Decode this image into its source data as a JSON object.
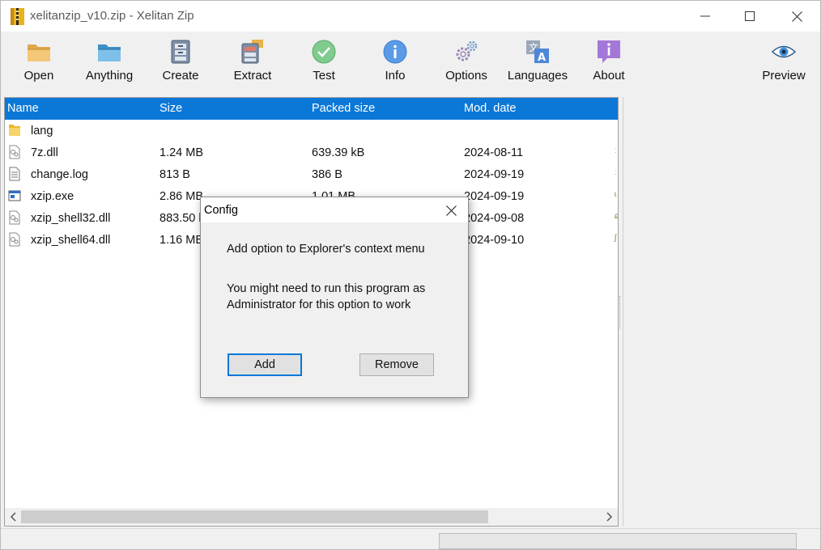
{
  "window": {
    "title": "xelitanzip_v10.zip - Xelitan Zip",
    "controls": [
      "minimize-icon",
      "maximize-icon",
      "close-icon"
    ]
  },
  "toolbar": {
    "buttons": [
      {
        "label": "Open",
        "icon": "open-folder-icon"
      },
      {
        "label": "Anything",
        "icon": "blue-folder-icon"
      },
      {
        "label": "Create",
        "icon": "create-archive-icon"
      },
      {
        "label": "Extract",
        "icon": "extract-archive-icon"
      },
      {
        "label": "Test",
        "icon": "check-circle-icon"
      },
      {
        "label": "Info",
        "icon": "info-icon"
      },
      {
        "label": "Options",
        "icon": "gears-icon"
      },
      {
        "label": "Languages",
        "icon": "languages-icon"
      },
      {
        "label": "About",
        "icon": "about-icon"
      },
      {
        "label": "Preview",
        "icon": "eye-icon"
      }
    ]
  },
  "file_list": {
    "columns": [
      "Name",
      "Size",
      "Packed size",
      "Mod. date"
    ],
    "rows": [
      {
        "name": "lang",
        "size": "",
        "packed": "",
        "date": "",
        "icon": "folder-icon"
      },
      {
        "name": "7z.dll",
        "size": "1.24 MB",
        "packed": "639.39 kB",
        "date": "2024-08-11",
        "icon": "dll-file-icon"
      },
      {
        "name": "change.log",
        "size": "813 B",
        "packed": "386 B",
        "date": "2024-09-19",
        "icon": "text-file-icon"
      },
      {
        "name": "xzip.exe",
        "size": "2.86 MB",
        "packed": "1.01 MB",
        "date": "2024-09-19",
        "icon": "exe-file-icon"
      },
      {
        "name": "xzip_shell32.dll",
        "size": "883.50 k",
        "packed": "",
        "date": "2024-09-08",
        "icon": "dll-file-icon"
      },
      {
        "name": "xzip_shell64.dll",
        "size": "1.16 MB",
        "packed": "",
        "date": "2024-09-10",
        "icon": "dll-file-icon"
      }
    ]
  },
  "statusbar": {
    "progress": 0
  },
  "dialog": {
    "title": "Config",
    "line1": "Add option to Explorer's context menu",
    "line2": "You might need to run this program as",
    "line3": "Administrator for this option to work",
    "add_label": "Add",
    "remove_label": "Remove"
  }
}
